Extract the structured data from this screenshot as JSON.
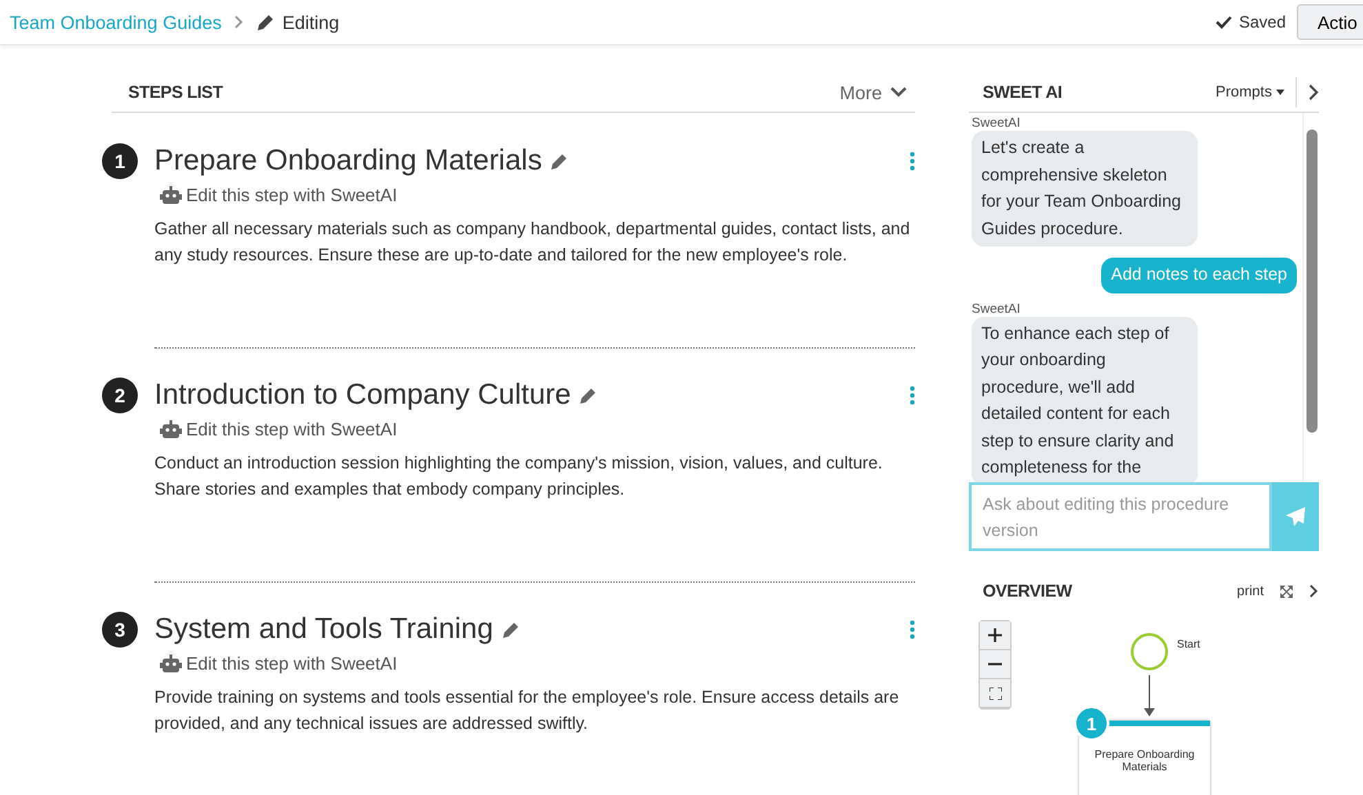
{
  "breadcrumb": {
    "parent": "Team Onboarding Guides",
    "current": "Editing"
  },
  "header_actions": {
    "saved": "Saved",
    "action_button": "Actio"
  },
  "steps_list": {
    "title": "STEPS LIST",
    "more": "More",
    "steps": [
      {
        "number": "1",
        "title": "Prepare Onboarding Materials",
        "ai_link": "Edit this step with SweetAI",
        "description": "Gather all necessary materials such as company handbook, departmental guides, contact lists, and any study resources. Ensure these are up-to-date and tailored for the new employee's role."
      },
      {
        "number": "2",
        "title": "Introduction to Company Culture",
        "ai_link": "Edit this step with SweetAI",
        "description": "Conduct an introduction session highlighting the company's mission, vision, values, and culture. Share stories and examples that embody company principles."
      },
      {
        "number": "3",
        "title": "System and Tools Training",
        "ai_link": "Edit this step with SweetAI",
        "description": "Provide training on systems and tools essential for the employee's role. Ensure access details are provided, and any technical issues are addressed swiftly."
      }
    ]
  },
  "sweet_ai": {
    "title": "SWEET AI",
    "prompts": "Prompts",
    "messages": [
      {
        "kind": "ai",
        "sender": "SweetAI",
        "text": "Let's create a comprehensive skeleton for your Team Onboarding Guides procedure."
      },
      {
        "kind": "user",
        "text": "Add notes to each step"
      },
      {
        "kind": "ai",
        "sender": "SweetAI",
        "text": "To enhance each step of your onboarding procedure, we'll add detailed content for each step to ensure clarity and completeness for the"
      }
    ],
    "input": {
      "placeholder": "Ask about editing this procedure version"
    }
  },
  "overview": {
    "title": "OVERVIEW",
    "print": "print",
    "start_label": "Start",
    "first_step": {
      "number": "1",
      "title": "Prepare Onboarding Materials"
    }
  }
}
